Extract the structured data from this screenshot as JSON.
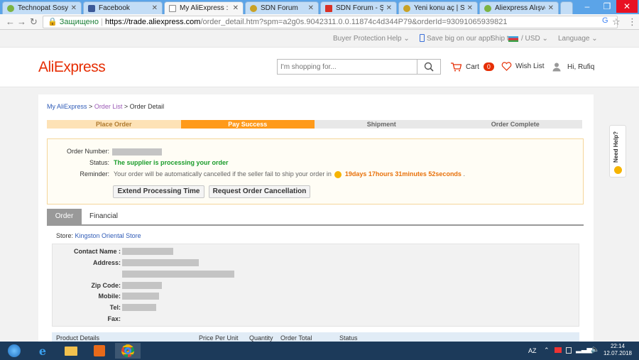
{
  "browser": {
    "tabs": [
      {
        "label": "Technopat Sosyal",
        "color": "#7cb342"
      },
      {
        "label": "Facebook",
        "color": "#3b5998"
      },
      {
        "label": "My AliExpress : Man",
        "color": "#777777"
      },
      {
        "label": "SDN Forum",
        "color": "#c9a227"
      },
      {
        "label": "SDN Forum - Şifre s",
        "color": "#d93025"
      },
      {
        "label": "Yeni konu aç | SDN F",
        "color": "#c9a227"
      },
      {
        "label": "Aliexpress Alışveriş F",
        "color": "#7cb342"
      }
    ],
    "address": {
      "secure_label": "Защищено",
      "domain": "https://trade.aliexpress.com",
      "path": "/order_detail.htm?spm=a2g0s.9042311.0.0.11874c4d344P79&orderId=93091065939821"
    }
  },
  "topstrip": {
    "buyer_protection": "Buyer Protection",
    "help": "Help ⌄",
    "app": "Save big on our app!",
    "ship_to": "Ship to",
    "currency": "/ USD ⌄",
    "language": "Language ⌄"
  },
  "header": {
    "logo": "AliExpress",
    "search_placeholder": "I'm shopping for...",
    "cart_label": "Cart",
    "cart_count": "0",
    "wishlist_label": "Wish List",
    "greeting": "Hi, Rufiq"
  },
  "breadcrumb": {
    "my": "My AliExpress",
    "sep1": ">",
    "order_list": "Order List",
    "sep2": ">",
    "current": "Order Detail"
  },
  "steps": [
    "Place Order",
    "Pay Success",
    "Shipment",
    "Order Complete"
  ],
  "order": {
    "number_label": "Order Number:",
    "status_label": "Status:",
    "status_value": "The supplier is processing your order",
    "reminder_label": "Reminder:",
    "reminder_text": "Your order will be automatically cancelled if the seller fail to ship your order in",
    "countdown": "19days 17hours 31minutes 52seconds",
    "countdown_end": ".",
    "extend_button": "Extend Processing Time",
    "cancel_button": "Request Order Cancellation"
  },
  "tabs": {
    "order": "Order",
    "financial": "Financial"
  },
  "store": {
    "label": "Store:",
    "name": "Kingston Oriental Store"
  },
  "address": {
    "contact": "Contact Name :",
    "address": "Address:",
    "zip": "Zip Code:",
    "mobile": "Mobile:",
    "tel": "Tel:",
    "fax": "Fax:"
  },
  "product_header": [
    "Product Details",
    "Price Per Unit",
    "Quantity",
    "Order Total",
    "Status"
  ],
  "need_help": "Need Help?",
  "taskbar": {
    "lang": "AZ",
    "time": "22:14",
    "date": "12.07.2018"
  }
}
